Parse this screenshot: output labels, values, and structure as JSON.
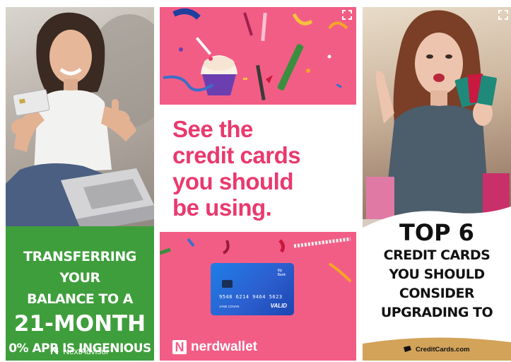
{
  "ads": [
    {
      "advertiser": "NextAdvisor",
      "headline_lines": [
        "TRANSFERRING YOUR",
        "BALANCE TO A",
        "21-MONTH",
        "0% APR IS INGENIOUS"
      ],
      "brand_name": "NextAdvisor",
      "colors": {
        "accent": "#3f9e3c",
        "text": "#ffffff"
      }
    },
    {
      "advertiser": "nerdwallet",
      "headline_lines": [
        "See the",
        "credit cards",
        "you should",
        "be using."
      ],
      "card": {
        "bank_line1": "My",
        "bank_line2": "Bank",
        "number": "9548 6214 9464 5623",
        "name": "JANE COVAN",
        "valid_label": "VALID"
      },
      "brand_name": "nerdwallet",
      "brand_mark": "N",
      "colors": {
        "accent": "#f25d86",
        "headline": "#e9396e",
        "card": "#2c5fcf"
      }
    },
    {
      "advertiser": "CreditCards.com",
      "headline_lines": [
        "TOP 6",
        "CREDIT CARDS",
        "YOU SHOULD",
        "CONSIDER",
        "UPGRADING TO"
      ],
      "brand_name": "CreditCards.com",
      "colors": {
        "accent": "#d3a35a",
        "text": "#111111"
      }
    }
  ],
  "icons": {
    "expand": "expand-icon",
    "nextadvisor_logo": "nextadvisor-logo-icon",
    "creditcards_logo": "creditcards-logo-icon"
  }
}
